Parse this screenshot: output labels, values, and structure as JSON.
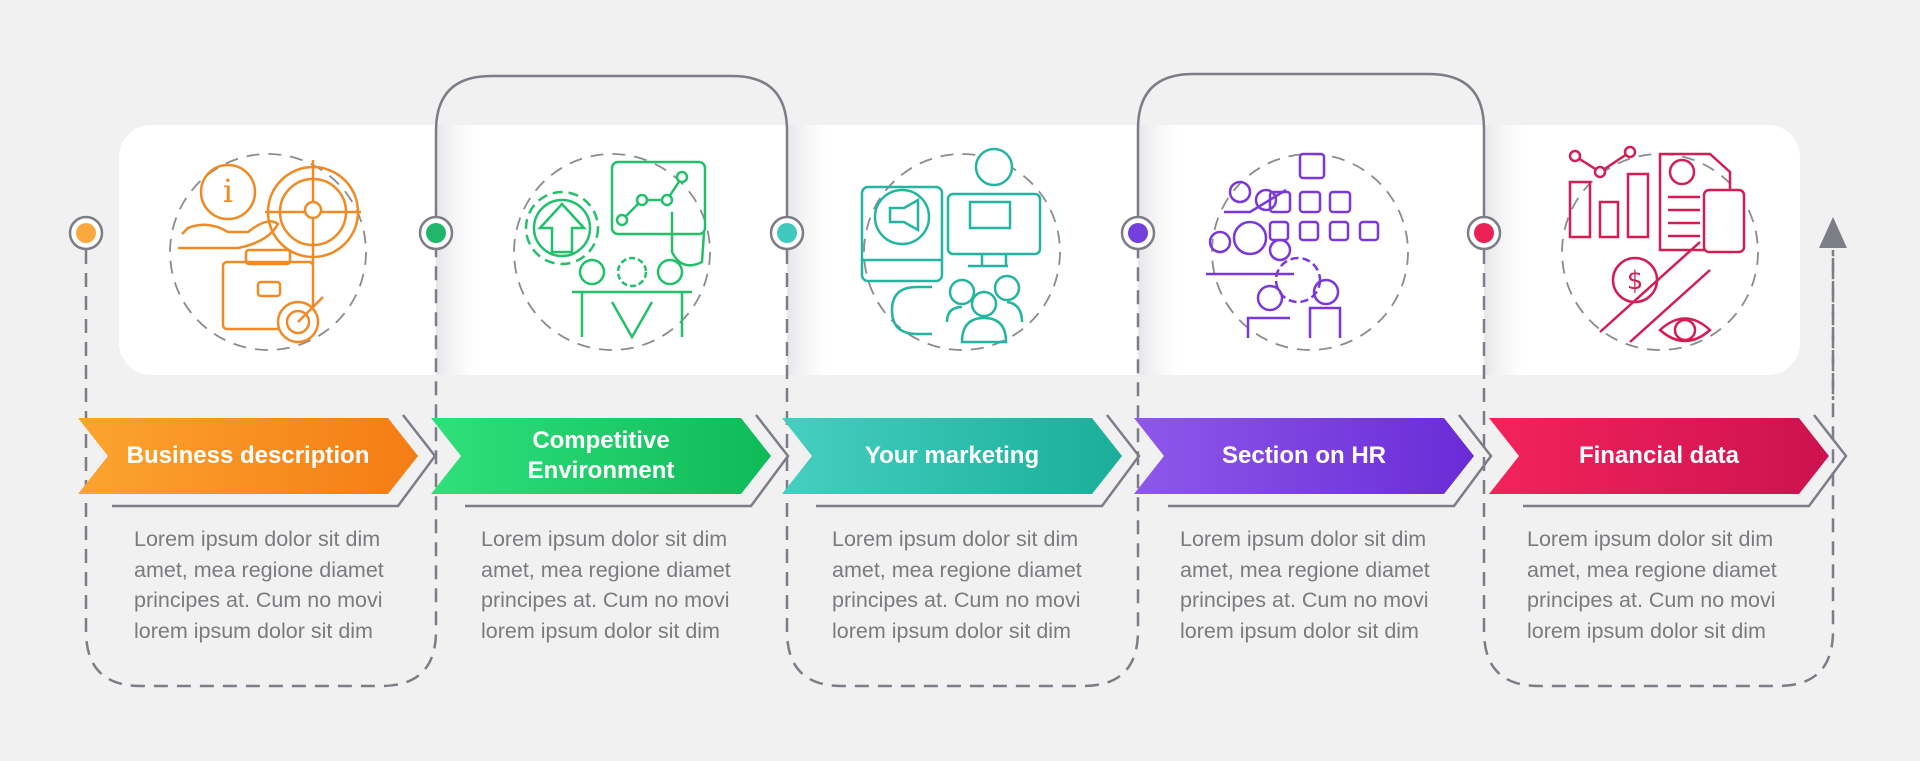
{
  "steps": [
    {
      "title": "Business description",
      "title_lines": [
        "Business description"
      ],
      "color_start": "#fba430",
      "color_end": "#f57c14",
      "dot_color": "#f9a73e",
      "icon": "business-info-target-icon",
      "description": [
        "Lorem ipsum dolor sit dim",
        "amet, mea regione diamet",
        "principes at. Cum no movi",
        "lorem ipsum dolor sit dim"
      ]
    },
    {
      "title": "Competitive Environment",
      "title_lines": [
        "Competitive",
        "Environment"
      ],
      "color_start": "#2fe07b",
      "color_end": "#0fba58",
      "dot_color": "#21b66a",
      "icon": "competitive-environment-icon",
      "description": [
        "Lorem ipsum dolor sit dim",
        "amet, mea regione diamet",
        "principes at. Cum no movi",
        "lorem ipsum dolor sit dim"
      ]
    },
    {
      "title": "Your marketing",
      "title_lines": [
        "Your marketing"
      ],
      "color_start": "#45cfc2",
      "color_end": "#1aae98",
      "dot_color": "#3fc8be",
      "icon": "marketing-megaphone-icon",
      "description": [
        "Lorem ipsum dolor sit dim",
        "amet, mea regione diamet",
        "principes at. Cum no movi",
        "lorem ipsum dolor sit dim"
      ]
    },
    {
      "title": "Section on HR",
      "title_lines": [
        "Section on HR"
      ],
      "color_start": "#8e58ea",
      "color_end": "#6a2bd6",
      "dot_color": "#7440dc",
      "icon": "hr-org-chart-icon",
      "description": [
        "Lorem ipsum dolor sit dim",
        "amet, mea regione diamet",
        "principes at. Cum no movi",
        "lorem ipsum dolor sit dim"
      ]
    },
    {
      "title": "Financial data",
      "title_lines": [
        "Financial data"
      ],
      "color_start": "#f3235a",
      "color_end": "#cc1250",
      "dot_color": "#ea2155",
      "icon": "financial-data-icon",
      "description": [
        "Lorem ipsum dolor sit dim",
        "amet, mea regione diamet",
        "principes at. Cum no movi",
        "lorem ipsum dolor sit dim"
      ]
    }
  ],
  "icon_colors": [
    "#f08a24",
    "#22c06a",
    "#24b5a0",
    "#7a38dc",
    "#d21e55"
  ],
  "line_color": "#7d7d87"
}
